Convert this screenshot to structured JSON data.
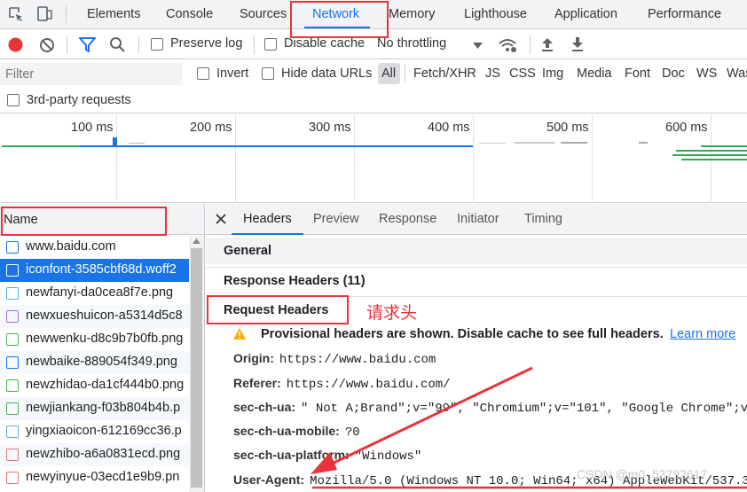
{
  "devtools": {
    "tabs": [
      "Elements",
      "Console",
      "Sources",
      "Network",
      "Memory",
      "Lighthouse",
      "Application",
      "Performance"
    ],
    "active_tab": "Network"
  },
  "network": {
    "controls": {
      "preserve_log": "Preserve log",
      "disable_cache": "Disable cache",
      "throttling": "No throttling"
    },
    "filter": {
      "placeholder": "Filter",
      "invert": "Invert",
      "hide_data_urls": "Hide data URLs",
      "types": [
        "All",
        "Fetch/XHR",
        "JS",
        "CSS",
        "Img",
        "Media",
        "Font",
        "Doc",
        "WS",
        "Was"
      ],
      "third_party": "3rd-party requests"
    },
    "timeline": {
      "ticks": [
        "100 ms",
        "200 ms",
        "300 ms",
        "400 ms",
        "500 ms",
        "600 ms"
      ]
    },
    "requests": {
      "column": "Name",
      "items": [
        {
          "name": "www.baidu.com",
          "icon": "document-icon"
        },
        {
          "name": "iconfont-3585cbf68d.woff2",
          "icon": "font-icon",
          "selected": true
        },
        {
          "name": "newfanyi-da0cea8f7e.png",
          "icon": "image-icon"
        },
        {
          "name": "newxueshuicon-a5314d5c8",
          "icon": "image-icon"
        },
        {
          "name": "newwenku-d8c9b7b0fb.png",
          "icon": "image-icon"
        },
        {
          "name": "newbaike-889054f349.png",
          "icon": "image-icon"
        },
        {
          "name": "newzhidao-da1cf444b0.png",
          "icon": "image-icon"
        },
        {
          "name": "newjiankang-f03b804b4b.p",
          "icon": "image-icon"
        },
        {
          "name": "yingxiaoicon-612169cc36.p",
          "icon": "image-icon"
        },
        {
          "name": "newzhibo-a6a0831ecd.png",
          "icon": "image-icon"
        },
        {
          "name": "newyinyue-03ecd1e9b9.pn",
          "icon": "image-icon"
        }
      ]
    },
    "details": {
      "tabs": [
        "Headers",
        "Preview",
        "Response",
        "Initiator",
        "Timing"
      ],
      "active_tab": "Headers",
      "sections": {
        "general": "General",
        "response_headers": "Response Headers (11)",
        "request_headers": "Request Headers"
      },
      "warning": "Provisional headers are shown. Disable cache to see full headers.",
      "learn_more": "Learn more",
      "headers": [
        {
          "key": "Origin:",
          "value": "https://www.baidu.com"
        },
        {
          "key": "Referer:",
          "value": "https://www.baidu.com/"
        },
        {
          "key": "sec-ch-ua:",
          "value": "\" Not A;Brand\";v=\"99\", \"Chromium\";v=\"101\", \"Google Chrome\";v="
        },
        {
          "key": "sec-ch-ua-mobile:",
          "value": "?0"
        },
        {
          "key": "sec-ch-ua-platform:",
          "value": "\"Windows\""
        },
        {
          "key": "User-Agent:",
          "value": "Mozilla/5.0 (Windows NT 10.0; Win64; x64) AppleWebKit/537.3"
        }
      ]
    }
  },
  "annotation": "请求头",
  "watermark": "CSDN @m0_53792617",
  "colors": {
    "accent": "#1a73e8",
    "record": "#e8333a",
    "annotation": "#e8333a"
  }
}
